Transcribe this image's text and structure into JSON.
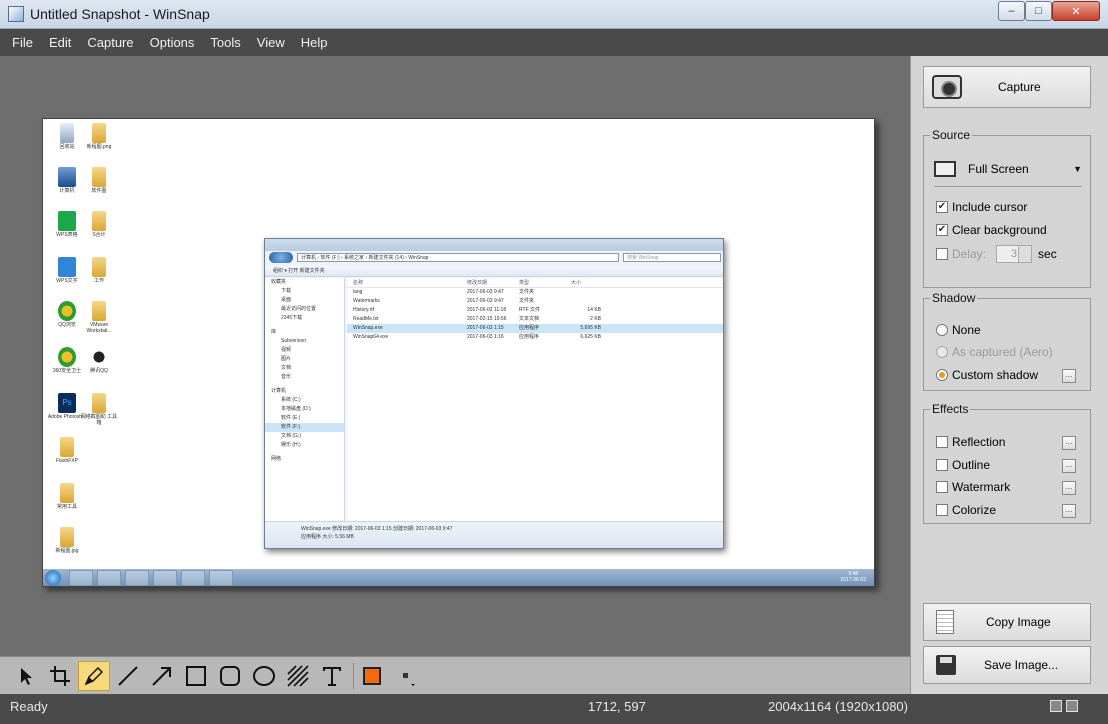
{
  "window": {
    "title": "Untitled Snapshot - WinSnap",
    "min_label": "–",
    "max_label": "□",
    "close_label": "✕"
  },
  "menu": [
    "File",
    "Edit",
    "Capture",
    "Options",
    "Tools",
    "View",
    "Help"
  ],
  "screenshot": {
    "desktop_icons": [
      {
        "label": "回收站",
        "icon": "bin"
      },
      {
        "label": "新程图.png",
        "icon": "folder"
      },
      {
        "label": "计算机",
        "icon": "pc"
      },
      {
        "label": "软件图",
        "icon": "folder"
      },
      {
        "label": "WPS表格",
        "icon": "green"
      },
      {
        "label": "S合计",
        "icon": "folder"
      },
      {
        "label": "WPS文字",
        "icon": "blue"
      },
      {
        "label": "工作",
        "icon": "folder"
      },
      {
        "label": "QQ浏览",
        "icon": "guard"
      },
      {
        "label": "VMware Workstati...",
        "icon": "folder"
      },
      {
        "label": "360安全卫士",
        "icon": "trash"
      },
      {
        "label": "腾讯QQ",
        "icon": "qq"
      },
      {
        "label": "Adobe Photosh...",
        "icon": "ps"
      },
      {
        "label": "网络截图助 工具箱",
        "icon": "folder"
      },
      {
        "label": "FlashFXP",
        "icon": "folder"
      },
      {
        "label": "常用工具",
        "icon": "folder"
      },
      {
        "label": "新程图.jpg",
        "icon": "folder"
      }
    ],
    "explorer": {
      "address": "计算机 › 软件 (F:) › 系统之家 › 新建文件夹 (14) › WinSnap",
      "search_placeholder": "搜索 WinSnap",
      "toolbar": "组织 ▾     打开     新建文件夹",
      "nav_items": [
        "收藏夹",
        "下载",
        "桌面",
        "最近访问的位置",
        "2345下载",
        "库",
        "Subversion",
        "视频",
        "图片",
        "文档",
        "音乐",
        "计算机",
        "系统 (C:)",
        "本地磁盘 (D:)",
        "软件 (E:)",
        "软件 (F:)",
        "文档 (G:)",
        "娱乐 (H:)",
        "网络"
      ],
      "columns": [
        "名称",
        "修改日期",
        "类型",
        "大小"
      ],
      "files": [
        {
          "name": "lang",
          "date": "2017-06-03 9:47",
          "type": "文件夹",
          "size": ""
        },
        {
          "name": "Watermarks",
          "date": "2017-06-03 9:47",
          "type": "文件夹",
          "size": ""
        },
        {
          "name": "History.rtf",
          "date": "2017-06-02 11:18",
          "type": "RTF 文件",
          "size": "14 KB"
        },
        {
          "name": "ReadMe.txt",
          "date": "2017-02-15 19:56",
          "type": "文本文档",
          "size": "2 KB"
        },
        {
          "name": "WinSnap.exe",
          "date": "2017-06-03 1:15",
          "type": "应用程序",
          "size": "5,695 KB"
        },
        {
          "name": "WinSnap64.exe",
          "date": "2017-06-03 1:16",
          "type": "应用程序",
          "size": "6,625 KB"
        }
      ],
      "status_line1": "WinSnap.exe   修改日期: 2017-06-03 1:15     创建日期: 2017-06-03 9:47",
      "status_line2": "应用程序        大小: 5.56 MB"
    },
    "clock_time": "9:48",
    "clock_date": "2017-06-03"
  },
  "panel": {
    "capture_label": "Capture",
    "source": {
      "legend": "Source",
      "selected": "Full Screen",
      "include_cursor": "Include cursor",
      "include_cursor_checked": true,
      "clear_background": "Clear background",
      "clear_background_checked": true,
      "delay_label": "Delay:",
      "delay_checked": false,
      "delay_value": "3",
      "delay_unit": "sec"
    },
    "shadow": {
      "legend": "Shadow",
      "none": "None",
      "as_captured": "As captured (Aero)",
      "custom": "Custom shadow",
      "selected": "custom"
    },
    "effects": {
      "legend": "Effects",
      "items": [
        "Reflection",
        "Outline",
        "Watermark",
        "Colorize"
      ]
    },
    "copy_label": "Copy Image",
    "save_label": "Save Image...",
    "small_button_label": "..."
  },
  "drawing_tools": {
    "active": "pen",
    "color": "#f36a0b",
    "tools": [
      "pointer",
      "crop",
      "pen",
      "line",
      "arrow",
      "rectangle",
      "rounded-rectangle",
      "ellipse",
      "hatch",
      "text"
    ]
  },
  "status": {
    "state": "Ready",
    "coords": "1712, 597",
    "size": "2004x1164 (1920x1080)"
  },
  "colors": {
    "menu_bg": "#4a4a4a",
    "canvas_bg": "#6e6e6e",
    "panel_bg": "#d4d4d4",
    "accent_orange": "#f36a0b",
    "active_tool_bg": "#f5d97b"
  }
}
